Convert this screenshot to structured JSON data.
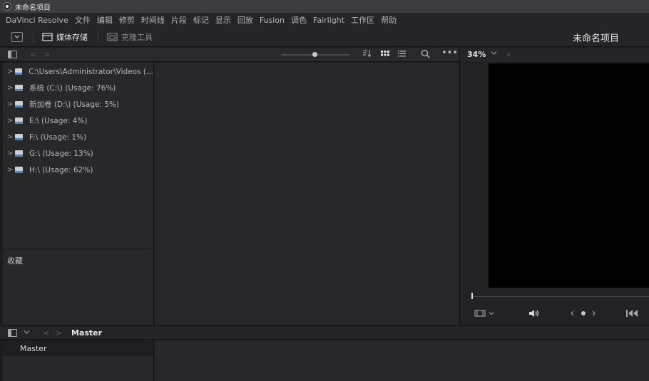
{
  "window": {
    "title": "未命名项目"
  },
  "menu": [
    "DaVinci Resolve",
    "文件",
    "编辑",
    "修剪",
    "时间线",
    "片段",
    "标记",
    "显示",
    "回放",
    "Fusion",
    "调色",
    "Fairlight",
    "工作区",
    "帮助"
  ],
  "toolbar": {
    "media_storage_label": "媒体存储",
    "clone_tool_label": "克隆工具",
    "project_name": "未命名项目"
  },
  "viewer": {
    "zoom": "34%"
  },
  "drives": [
    {
      "label": "C:\\Users\\Administrator\\Videos (..."
    },
    {
      "label": "系统 (C:\\) (Usage: 76%)"
    },
    {
      "label": "新加卷 (D:\\) (Usage: 5%)"
    },
    {
      "label": "E:\\ (Usage: 4%)"
    },
    {
      "label": "F:\\ (Usage: 1%)"
    },
    {
      "label": "G:\\ (Usage: 13%)"
    },
    {
      "label": "H:\\ (Usage: 62%)"
    }
  ],
  "favorites": {
    "label": "收藏"
  },
  "bins": {
    "breadcrumb": "Master",
    "items": [
      {
        "label": "Master"
      }
    ]
  },
  "icons": {
    "sort": "sort-icon",
    "grid": "grid-view-icon",
    "list": "list-view-icon",
    "search": "search-icon",
    "more": "more-icon",
    "speaker": "speaker-icon",
    "skip_back": "skip-back-icon"
  }
}
